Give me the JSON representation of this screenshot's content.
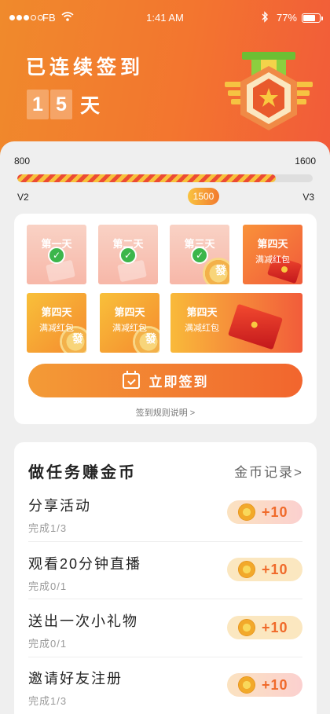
{
  "status_bar": {
    "carrier": "FB",
    "time": "1:41 AM",
    "battery": "77%"
  },
  "header": {
    "title": "已连续签到",
    "streak_digits": [
      "1",
      "5"
    ],
    "streak_unit": "天"
  },
  "progress": {
    "min": "800",
    "max": "1600",
    "current": "1500",
    "level_from": "V2",
    "level_to": "V3",
    "fill_fraction": 0.875
  },
  "checkin": {
    "days": [
      {
        "label": "第一天",
        "sub": ""
      },
      {
        "label": "第二天",
        "sub": ""
      },
      {
        "label": "第三天",
        "sub": ""
      },
      {
        "label": "第四天",
        "sub": "满减红包"
      },
      {
        "label": "第四天",
        "sub": "满减红包"
      },
      {
        "label": "第四天",
        "sub": "满减红包"
      },
      {
        "label": "第四天",
        "sub": "满减红包"
      }
    ],
    "coin_char": "發",
    "signin_label": "立即签到",
    "rules_link": "签到规则说明 >"
  },
  "tasks": {
    "title": "做任务赚金币",
    "log_link": "金币记录>",
    "items": [
      {
        "name": "分享活动",
        "progress": "完成1/3",
        "reward": "+10"
      },
      {
        "name": "观看20分钟直播",
        "progress": "完成0/1",
        "reward": "+10"
      },
      {
        "name": "送出一次小礼物",
        "progress": "完成0/1",
        "reward": "+10"
      },
      {
        "name": "邀请好友注册",
        "progress": "完成1/3",
        "reward": "+10"
      }
    ]
  }
}
